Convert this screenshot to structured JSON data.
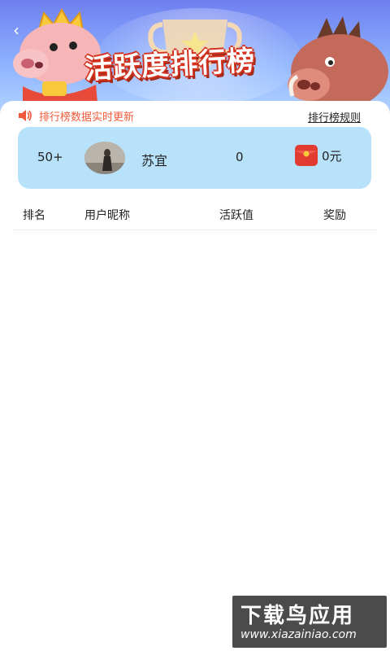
{
  "banner": {
    "title": "活跃度排行榜",
    "back_icon": "chevron-left-icon"
  },
  "notice": {
    "text": "排行榜数据实时更新",
    "icon": "speaker-icon"
  },
  "rules_link": "排行榜规则",
  "my_rank": {
    "rank": "50+",
    "nickname": "苏宜",
    "activity": "0",
    "reward": "0元"
  },
  "table": {
    "headers": [
      "排名",
      "用户昵称",
      "活跃值",
      "奖励"
    ]
  },
  "watermark": {
    "title": "下载鸟应用",
    "url": "www.xiazainiao.com"
  }
}
